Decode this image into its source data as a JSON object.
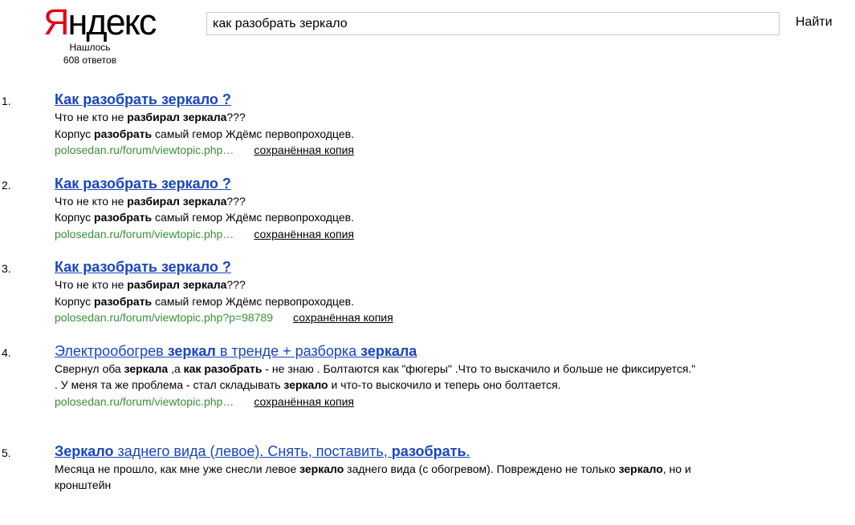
{
  "logo": {
    "first": "Я",
    "rest": "ндекс"
  },
  "stats": {
    "line1": "Нашлось",
    "line2": "608 ответов"
  },
  "search": {
    "query": "как разобрать зеркало",
    "button": "Найти"
  },
  "results": [
    {
      "num": "1.",
      "title": [
        {
          "t": "Как разобрать зеркало ?",
          "b": true
        }
      ],
      "lines": [
        [
          {
            "t": "Что не кто не "
          },
          {
            "t": "разбирал зеркала",
            "b": true
          },
          {
            "t": "???"
          }
        ],
        [
          {
            "t": "Корпус "
          },
          {
            "t": "разобрать",
            "b": true
          },
          {
            "t": " самый гемор Ждёмс первопроходцев."
          }
        ]
      ],
      "url": "polosedan.ru/forum/viewtopic.php…",
      "cache": "сохранённая копия"
    },
    {
      "num": "2.",
      "title": [
        {
          "t": "Как разобрать зеркало ?",
          "b": true
        }
      ],
      "lines": [
        [
          {
            "t": "Что не кто не "
          },
          {
            "t": "разбирал зеркала",
            "b": true
          },
          {
            "t": "???"
          }
        ],
        [
          {
            "t": "Корпус "
          },
          {
            "t": "разобрать",
            "b": true
          },
          {
            "t": " самый гемор Ждёмс первопроходцев."
          }
        ]
      ],
      "url": "polosedan.ru/forum/viewtopic.php…",
      "cache": "сохранённая копия"
    },
    {
      "num": "3.",
      "title": [
        {
          "t": "Как разобрать зеркало ?",
          "b": true
        }
      ],
      "lines": [
        [
          {
            "t": "Что не кто не "
          },
          {
            "t": "разбирал зеркала",
            "b": true
          },
          {
            "t": "???"
          }
        ],
        [
          {
            "t": "Корпус "
          },
          {
            "t": "разобрать",
            "b": true
          },
          {
            "t": " самый гемор Ждёмс первопроходцев."
          }
        ]
      ],
      "url": "polosedan.ru/forum/viewtopic.php?p=98789",
      "cache": "сохранённая копия"
    },
    {
      "num": "4.",
      "title": [
        {
          "t": "Электрообогрев "
        },
        {
          "t": "зеркал",
          "b": true
        },
        {
          "t": " в тренде + разборка "
        },
        {
          "t": "зеркала",
          "b": true
        }
      ],
      "lines": [
        [
          {
            "t": "Свернул оба "
          },
          {
            "t": "зеркала",
            "b": true
          },
          {
            "t": " ,а "
          },
          {
            "t": "как разобрать",
            "b": true
          },
          {
            "t": " - не знаю . Болтаются как \"фюгеры\" .Что то выскачило и больше не фиксируется.\" . У меня та же проблема - стал складывать "
          },
          {
            "t": "зеркало",
            "b": true
          },
          {
            "t": " и что-то выскочило и теперь оно болтается."
          }
        ]
      ],
      "url": "polosedan.ru/forum/viewtopic.php…",
      "cache": "сохранённая копия",
      "tall": true
    },
    {
      "num": "5.",
      "title": [
        {
          "t": "Зеркало",
          "b": true
        },
        {
          "t": " заднего вида (левое). Снять, поставить, "
        },
        {
          "t": "разобрать",
          "b": true
        },
        {
          "t": "."
        }
      ],
      "lines": [
        [
          {
            "t": "Месяца не прошло, как мне уже снесли левое "
          },
          {
            "t": "зеркало",
            "b": true
          },
          {
            "t": " заднего вида (с обогревом). Повреждено не только "
          },
          {
            "t": "зеркало",
            "b": true
          },
          {
            "t": ", но и кронштейн"
          }
        ]
      ],
      "url": "",
      "cache": ""
    }
  ]
}
